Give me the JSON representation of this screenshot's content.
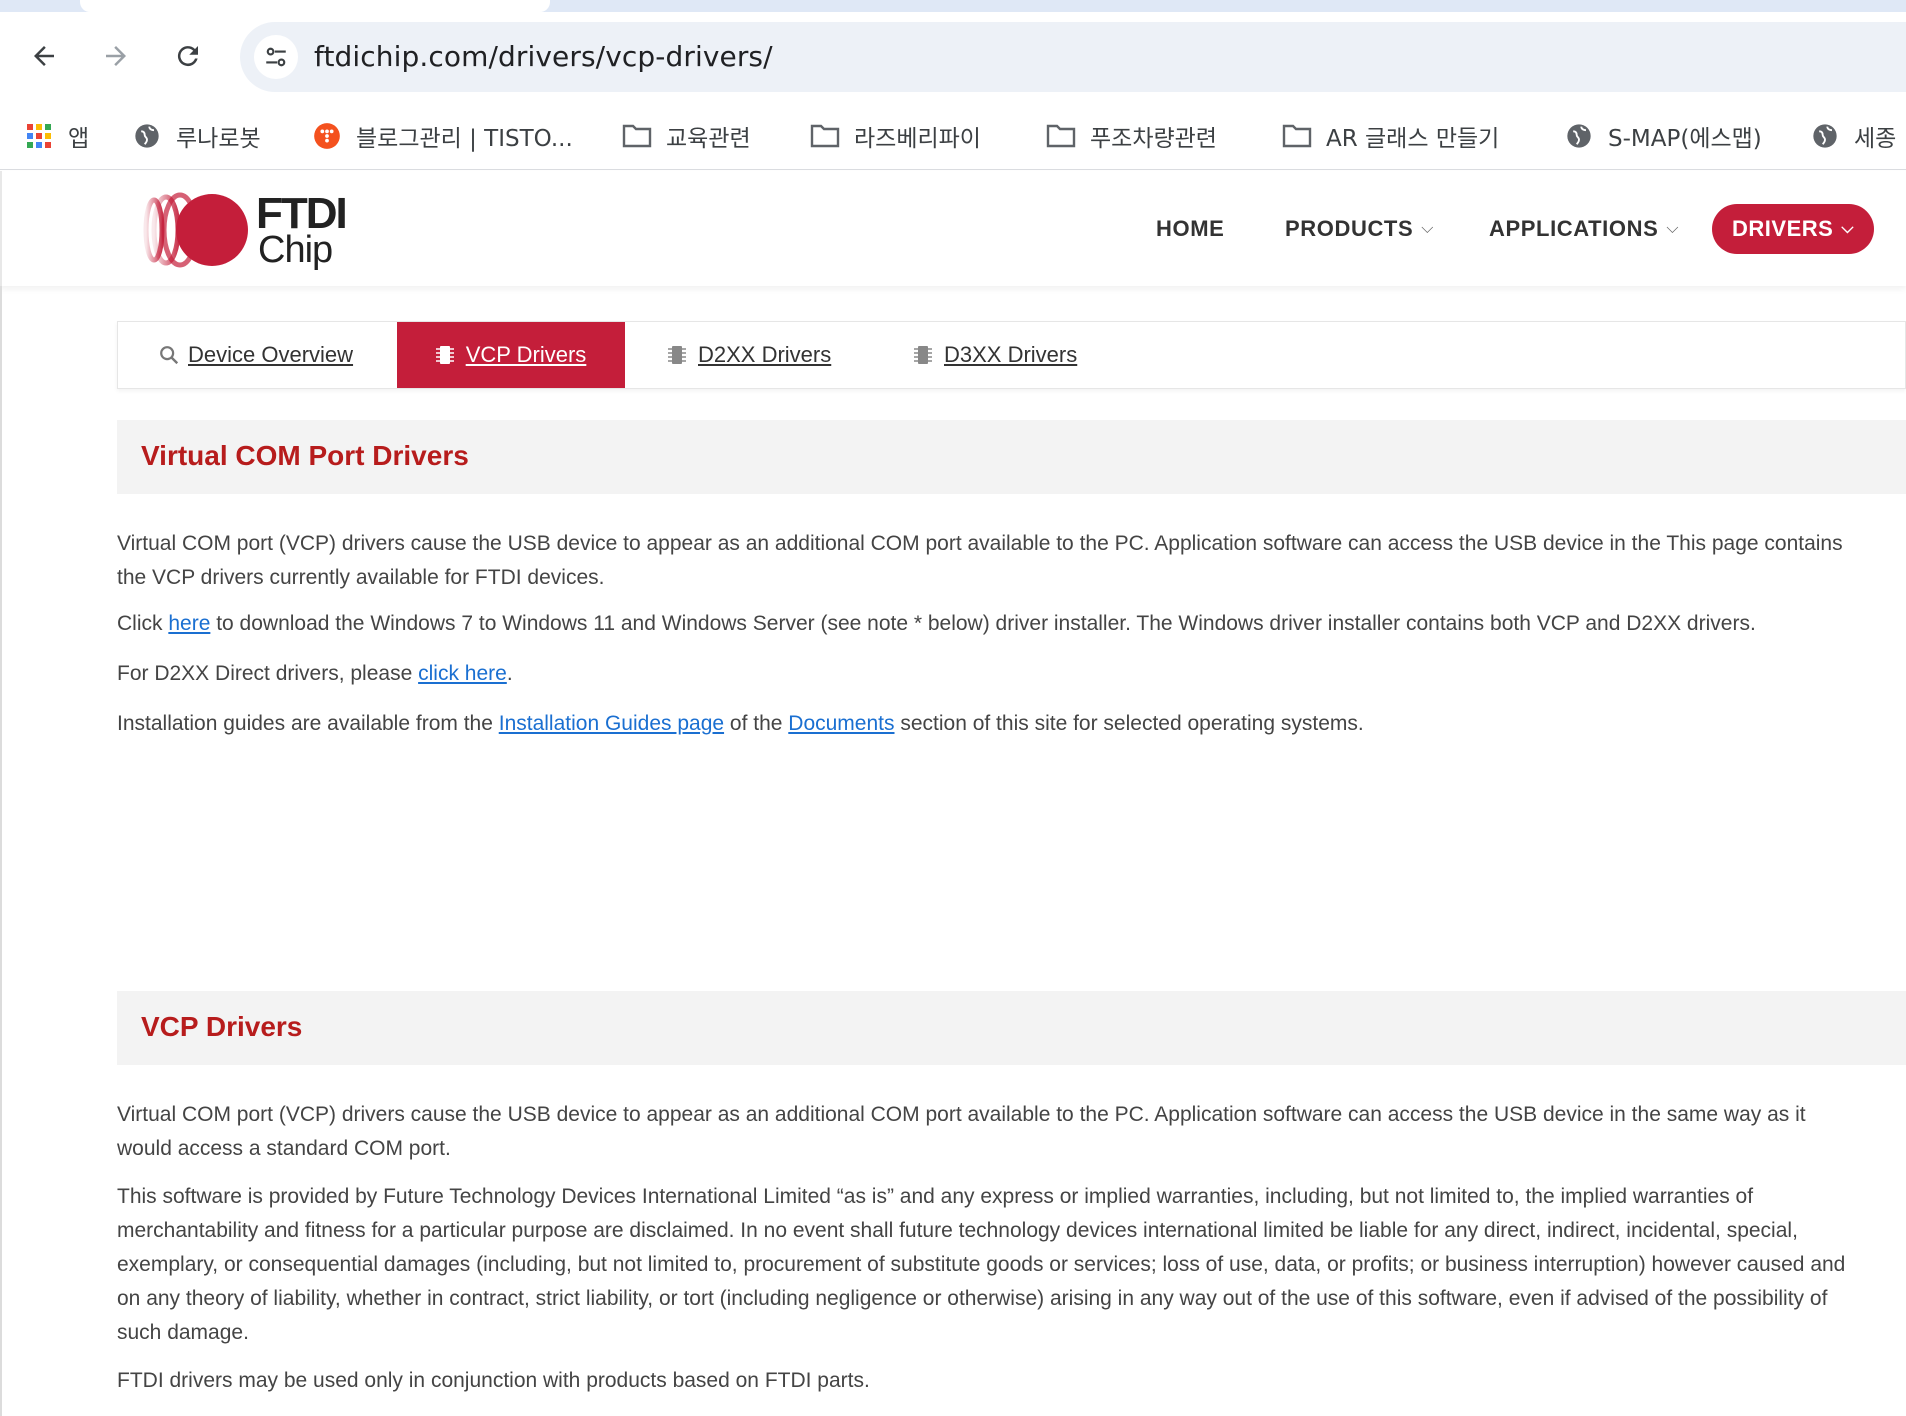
{
  "browser": {
    "url": "ftdichip.com/drivers/vcp-drivers/",
    "bookmarks": [
      {
        "label": "앱",
        "icon": "apps-grid-icon"
      },
      {
        "label": "루나로봇",
        "icon": "globe-icon"
      },
      {
        "label": "블로그관리 | TISTO...",
        "icon": "tistory-icon"
      },
      {
        "label": "교육관련",
        "icon": "folder-icon"
      },
      {
        "label": "라즈베리파이",
        "icon": "folder-icon"
      },
      {
        "label": "푸조차량관련",
        "icon": "folder-icon"
      },
      {
        "label": "AR 글래스 만들기",
        "icon": "folder-icon"
      },
      {
        "label": "S-MAP(에스맵)",
        "icon": "globe-icon"
      },
      {
        "label": "세종",
        "icon": "globe-icon"
      }
    ]
  },
  "header": {
    "logo_line1": "FTDI",
    "logo_line2": "Chip",
    "nav": [
      {
        "label": "HOME"
      },
      {
        "label": "PRODUCTS"
      },
      {
        "label": "APPLICATIONS"
      },
      {
        "label": "DRIVERS"
      }
    ],
    "chevron": "⌵"
  },
  "subtabs": [
    {
      "label": "Device Overview",
      "icon": "search-icon"
    },
    {
      "label": "VCP Drivers",
      "icon": "chip-icon",
      "active": true
    },
    {
      "label": "D2XX Drivers",
      "icon": "chip-icon"
    },
    {
      "label": "D3XX Drivers",
      "icon": "chip-icon"
    }
  ],
  "section1": {
    "title": "Virtual COM Port Drivers",
    "p1": "Virtual COM port (VCP) drivers cause the USB device to appear as an additional COM port available to the PC. Application software can access the USB device in the This page contains the VCP drivers currently available for FTDI devices.",
    "p2_pre": "Click ",
    "p2_link": "here",
    "p2_post": " to download the Windows 7 to Windows 11 and Windows Server (see note * below) driver installer. The Windows driver installer contains both VCP and D2XX drivers.",
    "p3_pre": "For D2XX Direct drivers, please ",
    "p3_link": "click here",
    "p3_post": ".",
    "p4_pre": "Installation guides are available from the ",
    "p4_link1": "Installation Guides page",
    "p4_mid": " of the ",
    "p4_link2": "Documents",
    "p4_post": " section of this site for selected operating systems."
  },
  "section2": {
    "title": "VCP Drivers",
    "p1": "Virtual COM port (VCP) drivers cause the USB device to appear as an additional COM port available to the PC. Application software can access the USB device in the same way as it would access a standard COM port.",
    "p2": "This software is provided by Future Technology Devices International Limited “as is” and any express or implied warranties, including, but not limited to, the implied warranties of merchantability and fitness for a particular purpose are disclaimed. In no event shall future technology devices international limited be liable for any direct, indirect, incidental, special, exemplary, or consequential damages (including, but not limited to, procurement of substitute goods or services; loss of use, data, or profits; or business interruption) however caused and on any theory of liability, whether in contract, strict liability, or tort (including negligence or otherwise) arising in any way out of the use of this software, even if advised of the possibility of such damage.",
    "p3": "FTDI drivers may be used only in conjunction with products based on FTDI parts."
  },
  "colors": {
    "brand_red": "#c41e3a",
    "link_blue": "#1a6fd1",
    "heading_red": "#b71c1c"
  }
}
